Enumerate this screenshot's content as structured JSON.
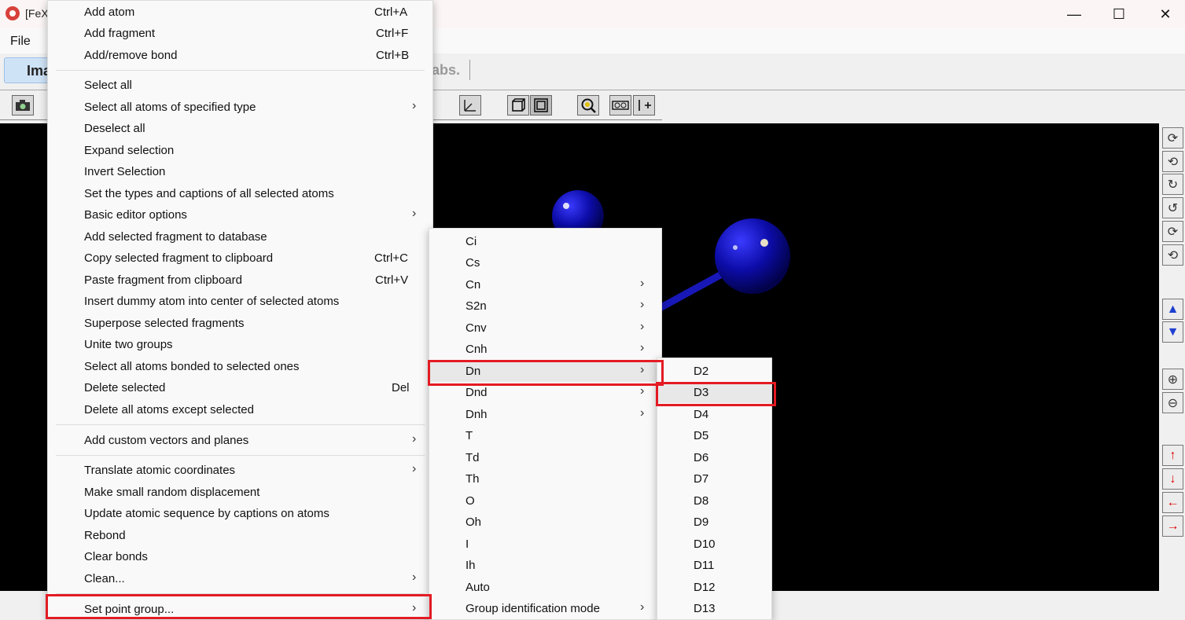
{
  "window": {
    "title": "[FeX",
    "minimize_glyph": "—",
    "maximize_glyph": "☐",
    "close_glyph": "✕"
  },
  "menubar": {
    "file_label": "File"
  },
  "tabs": {
    "active_label": "Ima",
    "abs_label": "abs."
  },
  "context_menu": {
    "items": [
      {
        "label": "Add atom",
        "shortcut": "Ctrl+A"
      },
      {
        "label": "Add fragment",
        "shortcut": "Ctrl+F"
      },
      {
        "label": "Add/remove bond",
        "shortcut": "Ctrl+B"
      },
      {
        "label": "Select all"
      },
      {
        "label": "Select all atoms of specified type",
        "submenu": true
      },
      {
        "label": "Deselect all"
      },
      {
        "label": "Expand selection"
      },
      {
        "label": "Invert Selection"
      },
      {
        "label": "Set the types and captions of all selected atoms"
      },
      {
        "label": "Basic editor options",
        "submenu": true
      },
      {
        "label": "Add selected fragment to database"
      },
      {
        "label": "Copy selected fragment to clipboard",
        "shortcut": "Ctrl+C"
      },
      {
        "label": "Paste fragment from clipboard",
        "shortcut": "Ctrl+V"
      },
      {
        "label": "Insert dummy atom into center of selected atoms"
      },
      {
        "label": "Superpose selected fragments"
      },
      {
        "label": "Unite two groups"
      },
      {
        "label": "Select all atoms bonded to selected ones"
      },
      {
        "label": "Delete selected",
        "shortcut": "Del"
      },
      {
        "label": "Delete all atoms except selected"
      },
      {
        "label": "Add custom vectors and planes",
        "submenu": true
      },
      {
        "label": "Translate atomic coordinates",
        "submenu": true
      },
      {
        "label": "Make small random displacement"
      },
      {
        "label": "Update atomic sequence by captions on atoms"
      },
      {
        "label": "Rebond"
      },
      {
        "label": "Clear bonds"
      },
      {
        "label": "Clean...",
        "submenu": true
      },
      {
        "label": "Set point group...",
        "submenu": true
      }
    ]
  },
  "point_group_menu": {
    "items": [
      {
        "label": "Ci"
      },
      {
        "label": "Cs"
      },
      {
        "label": "Cn",
        "submenu": true
      },
      {
        "label": "S2n",
        "submenu": true
      },
      {
        "label": "Cnv",
        "submenu": true
      },
      {
        "label": "Cnh",
        "submenu": true
      },
      {
        "label": "Dn",
        "submenu": true
      },
      {
        "label": "Dnd",
        "submenu": true
      },
      {
        "label": "Dnh",
        "submenu": true
      },
      {
        "label": "T"
      },
      {
        "label": "Td"
      },
      {
        "label": "Th"
      },
      {
        "label": "O"
      },
      {
        "label": "Oh"
      },
      {
        "label": "I"
      },
      {
        "label": "Ih"
      },
      {
        "label": "Auto"
      },
      {
        "label": "Group identification mode",
        "submenu": true
      }
    ]
  },
  "dn_menu": {
    "items": [
      "D2",
      "D3",
      "D4",
      "D5",
      "D6",
      "D7",
      "D8",
      "D9",
      "D10",
      "D11",
      "D12",
      "D13"
    ]
  },
  "submenu_arrow": "›",
  "toolbar_icons": [
    "camera-icon",
    "axes-icon",
    "box-icon",
    "box-selected-icon",
    "zoom-target-icon",
    "stereo-icon",
    "add-axis-icon"
  ],
  "side_toolbar_icons": [
    {
      "name": "rotate-x-cw-icon",
      "glyph": "⟳"
    },
    {
      "name": "rotate-x-ccw-icon",
      "glyph": "⟲"
    },
    {
      "name": "rotate-y-cw-icon",
      "glyph": "↻"
    },
    {
      "name": "rotate-y-ccw-icon",
      "glyph": "↺"
    },
    {
      "name": "rotate-z-cw-icon",
      "glyph": "⟳"
    },
    {
      "name": "rotate-z-ccw-icon",
      "glyph": "⟲"
    },
    {
      "name": "move-forward-icon",
      "glyph": "▲"
    },
    {
      "name": "move-backward-icon",
      "glyph": "▼"
    },
    {
      "name": "zoom-in-icon",
      "glyph": "⊕"
    },
    {
      "name": "zoom-out-icon",
      "glyph": "⊖"
    },
    {
      "name": "pan-up-icon",
      "glyph": "↑"
    },
    {
      "name": "pan-down-icon",
      "glyph": "↓"
    },
    {
      "name": "pan-left-icon",
      "glyph": "←"
    },
    {
      "name": "pan-right-icon",
      "glyph": "→"
    }
  ],
  "colors": {
    "highlight": "#e31b23",
    "atom": "#0a0a9e",
    "viewport_bg": "#000000",
    "active_tab": "#cfe3f7"
  }
}
